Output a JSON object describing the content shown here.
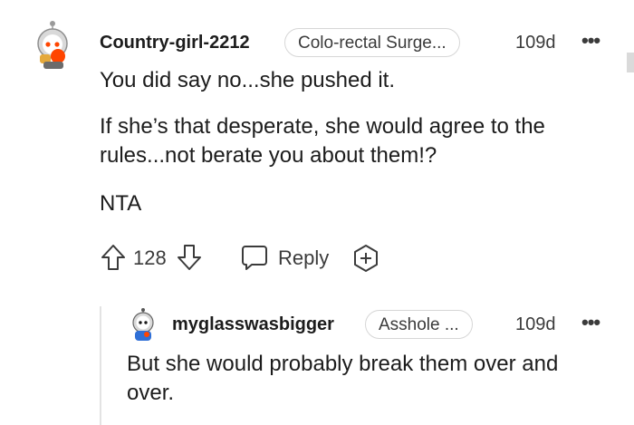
{
  "comment": {
    "username": "Country-girl-2212",
    "flair": "Colo-rectal Surge...",
    "time": "109d",
    "more": "•••",
    "body": [
      "You did say no...she pushed it.",
      "If she’s that desperate, she would agree to the rules...not berate you about them!?",
      "NTA"
    ],
    "vote_count": "128",
    "reply_label": "Reply"
  },
  "reply": {
    "username": "myglasswasbigger",
    "flair": "Asshole ...",
    "time": "109d",
    "more": "•••",
    "body": "But she would probably break them over and over."
  },
  "colors": {
    "text": "#1c1c1c",
    "muted": "#3b3b3b",
    "border": "#d6d6d6",
    "avatar_accent": "#ff4500"
  }
}
